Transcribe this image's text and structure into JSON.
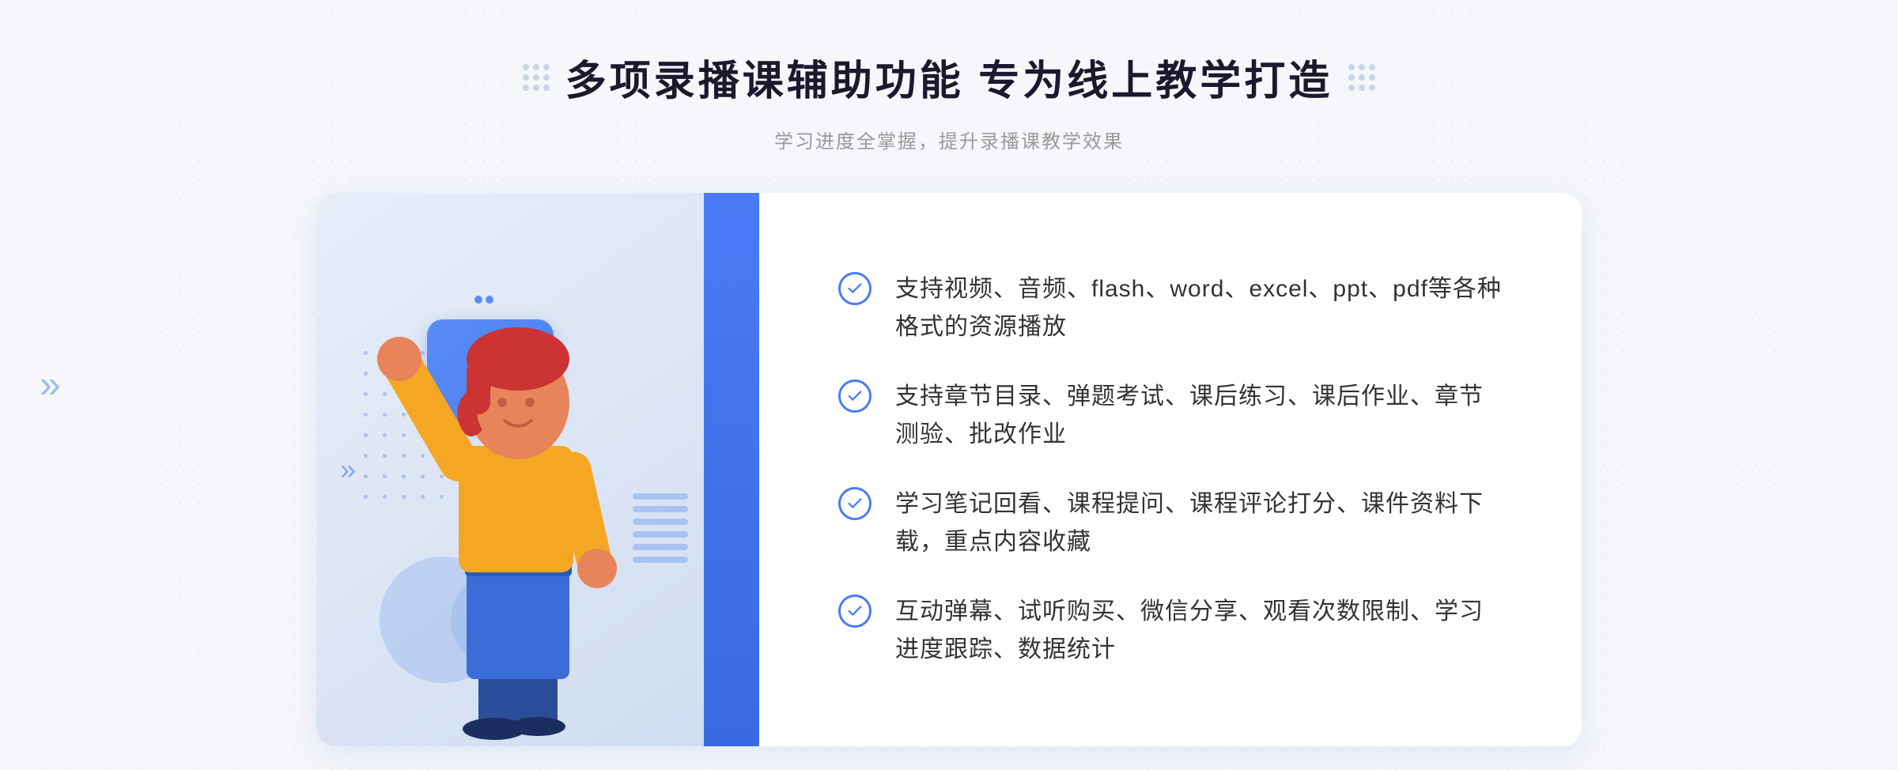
{
  "header": {
    "title": "多项录播课辅助功能 专为线上教学打造",
    "subtitle": "学习进度全掌握，提升录播课教学效果"
  },
  "features": [
    {
      "id": 1,
      "text": "支持视频、音频、flash、word、excel、ppt、pdf等各种格式的资源播放"
    },
    {
      "id": 2,
      "text": "支持章节目录、弹题考试、课后练习、课后作业、章节测验、批改作业"
    },
    {
      "id": 3,
      "text": "学习笔记回看、课程提问、课程评论打分、课件资料下载，重点内容收藏"
    },
    {
      "id": 4,
      "text": "互动弹幕、试听购买、微信分享、观看次数限制、学习进度跟踪、数据统计"
    }
  ],
  "colors": {
    "primary": "#4a7af5",
    "title": "#1a1a2e",
    "text": "#333333",
    "subtitle": "#999999",
    "decoration": "#c8d4e8"
  },
  "icons": {
    "check": "check-circle-icon",
    "play": "play-icon",
    "chevron": "chevron-right-icon"
  }
}
